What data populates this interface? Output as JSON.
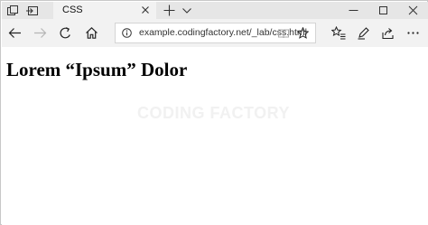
{
  "tabstrip": {
    "tab_title": "CSS",
    "icons": {
      "tab_actions": "tab-actions-icon",
      "set_aside": "set-aside-tabs-icon",
      "close_tab": "close-icon",
      "new_tab": "plus-icon",
      "tab_preview": "chevron-down-icon"
    }
  },
  "window": {
    "icons": {
      "minimize": "minimize-icon",
      "maximize": "maximize-icon",
      "close": "close-icon"
    }
  },
  "toolbar": {
    "url": "example.codingfactory.net/_lab/css.html",
    "icons": {
      "back": "back-arrow-icon",
      "forward": "forward-arrow-icon",
      "refresh": "refresh-icon",
      "home": "home-icon",
      "site_info": "info-icon",
      "reading_view": "reading-view-icon",
      "favorite": "star-icon",
      "favorites_hub": "favorites-list-icon",
      "notes": "pen-icon",
      "share": "share-icon",
      "more": "more-icon"
    }
  },
  "page": {
    "heading": "Lorem “Ipsum” Dolor",
    "watermark": "CODING FACTORY"
  },
  "colors": {
    "tabstrip_bg": "#e6e6e6",
    "toolbar_bg": "#f2f2f2",
    "content_bg": "#ffffff",
    "watermark": "#f1f1f1"
  }
}
